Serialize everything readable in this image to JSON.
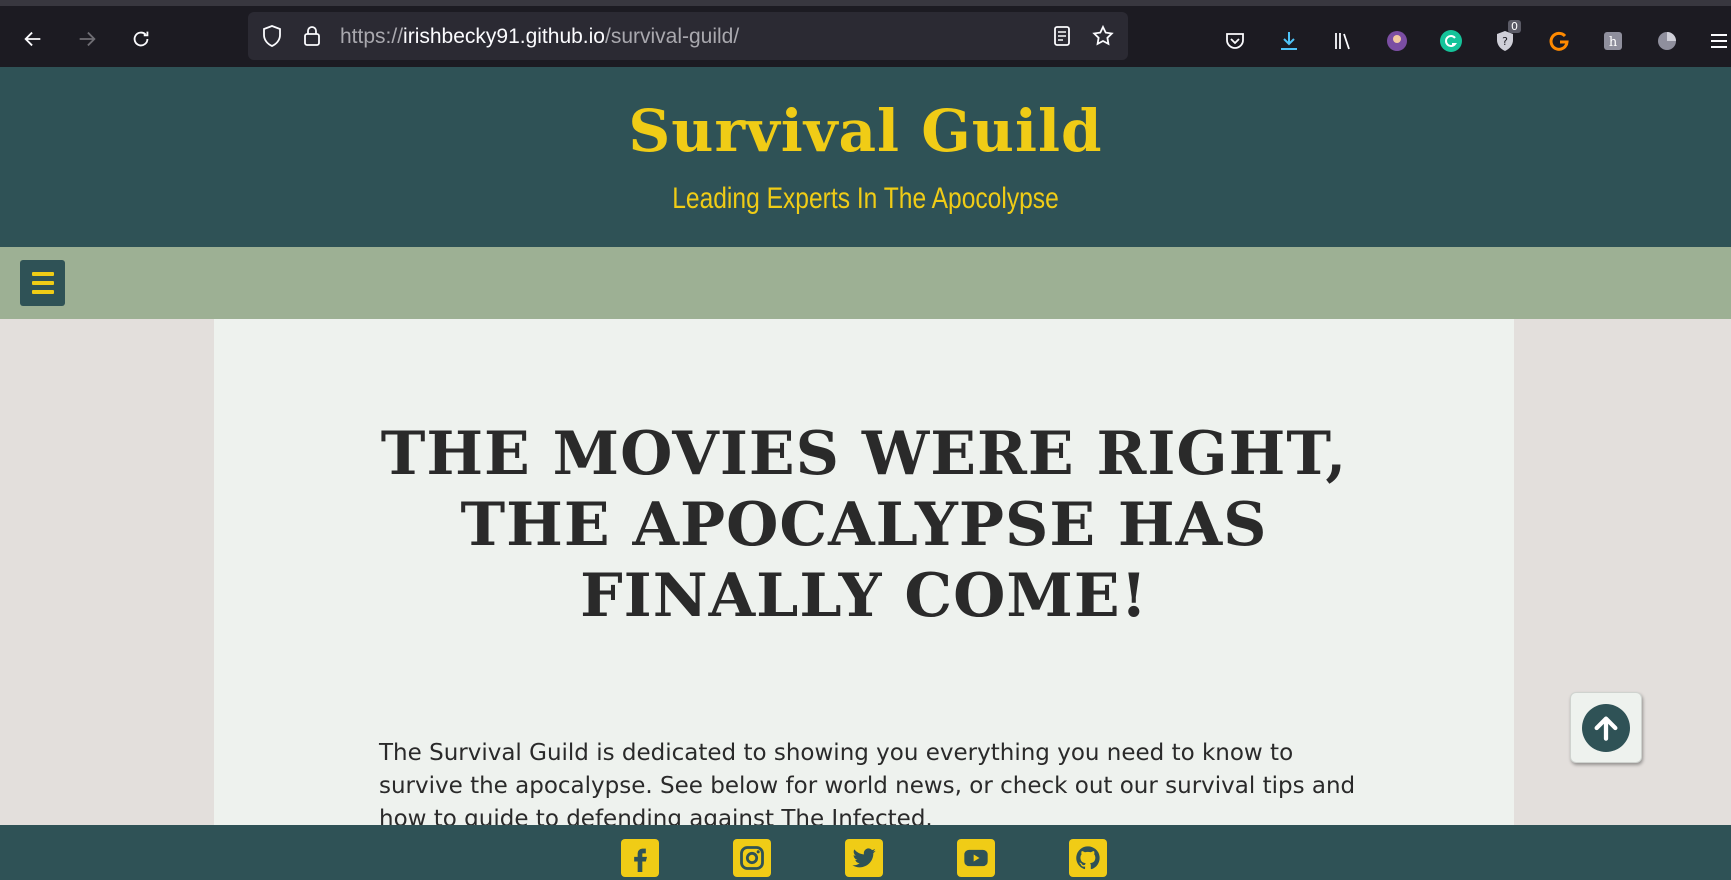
{
  "browser": {
    "url_scheme": "https://",
    "url_host": "irishbecky91.github.io",
    "url_path": "/survival-guild/",
    "badge_count": "0"
  },
  "site": {
    "title": "Survival Guild",
    "tagline": "Leading Experts In The Apocolypse"
  },
  "main": {
    "headline": "THE MOVIES WERE RIGHT, THE APOCALYPSE HAS FINALLY COME!",
    "intro": "The Survival Guild is dedicated to showing you everything you need to know to survive the apocalypse. See below for world news, or check out our survival tips and how to guide to defending against The Infected."
  },
  "footer": {
    "social": [
      "facebook-icon",
      "instagram-icon",
      "twitter-icon",
      "youtube-icon",
      "github-icon"
    ]
  },
  "colors": {
    "header_bg": "#2f5256",
    "accent_yellow": "#f0cc16",
    "nav_bg": "#9db094",
    "content_bg": "#eef2ee",
    "page_bg": "#e3dfdc"
  }
}
